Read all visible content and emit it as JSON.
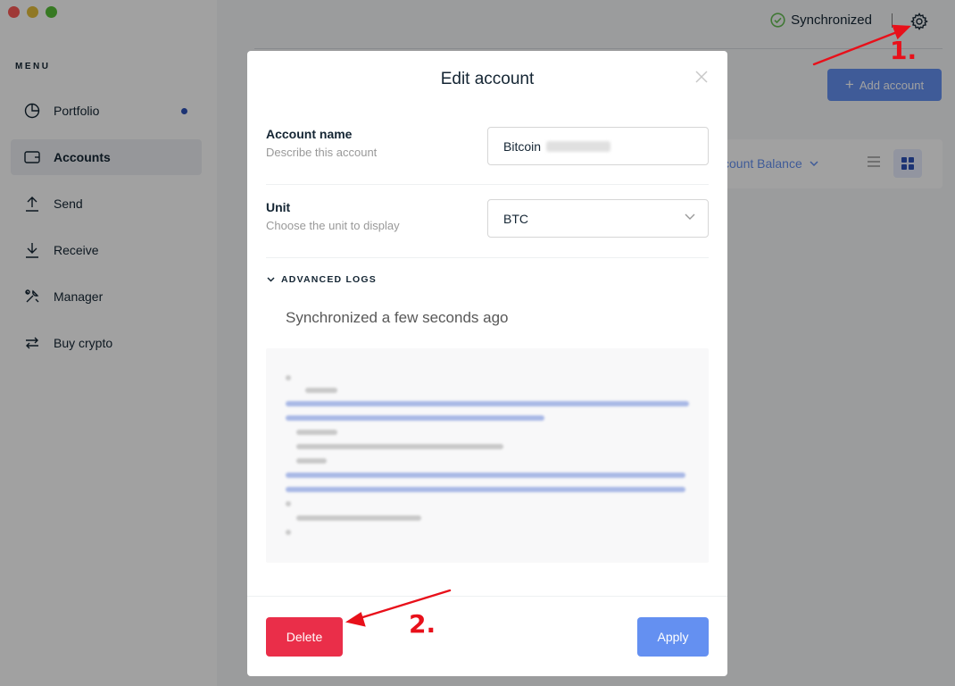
{
  "sidebar": {
    "menu_title": "MENU",
    "items": [
      {
        "label": "Portfolio",
        "icon": "pie-chart-icon"
      },
      {
        "label": "Accounts",
        "icon": "wallet-icon"
      },
      {
        "label": "Send",
        "icon": "arrow-up-icon"
      },
      {
        "label": "Receive",
        "icon": "arrow-down-icon"
      },
      {
        "label": "Manager",
        "icon": "tools-icon"
      },
      {
        "label": "Buy crypto",
        "icon": "exchange-icon"
      }
    ]
  },
  "topbar": {
    "sync_label": "Synchronized",
    "add_account_label": "Add account",
    "sort_label": "ccount Balance"
  },
  "modal": {
    "title": "Edit account",
    "account_name": {
      "label": "Account name",
      "description": "Describe this account",
      "value": "Bitcoin"
    },
    "unit": {
      "label": "Unit",
      "description": "Choose the unit to display",
      "value": "BTC"
    },
    "advanced_logs_label": "ADVANCED LOGS",
    "sync_text": "Synchronized a few seconds ago",
    "delete_label": "Delete",
    "apply_label": "Apply"
  },
  "annotations": {
    "label_1": "1.",
    "label_2": "2.",
    "color": "#e8101a"
  },
  "colors": {
    "accent": "#6490f1",
    "danger": "#ea2e49",
    "success": "#66be54"
  }
}
